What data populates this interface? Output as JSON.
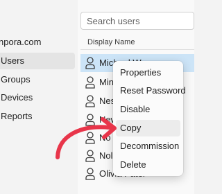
{
  "sidebar": {
    "domain": "npora.com",
    "items": [
      {
        "label": "Users",
        "active": true
      },
      {
        "label": "Groups",
        "active": false
      },
      {
        "label": "Devices",
        "active": false
      },
      {
        "label": "Reports",
        "active": false
      }
    ]
  },
  "search": {
    "placeholder": "Search users"
  },
  "table": {
    "column_header": "Display Name",
    "rows": [
      {
        "name": "Michael Wong",
        "selected": true
      },
      {
        "name": "Min",
        "selected": false
      },
      {
        "name": "Nes",
        "selected": false
      },
      {
        "name": "New",
        "selected": false
      },
      {
        "name": "No",
        "selected": false
      },
      {
        "name": "Nol",
        "selected": false
      },
      {
        "name": "Olivia Pater",
        "selected": false
      }
    ]
  },
  "context_menu": {
    "items": [
      {
        "label": "Properties"
      },
      {
        "label": "Reset Password"
      },
      {
        "label": "Disable"
      },
      {
        "label": "Copy",
        "highlighted": true
      },
      {
        "label": "Decommission"
      },
      {
        "label": "Delete"
      }
    ]
  },
  "annotation": {
    "arrow_color": "#e8354a",
    "target": "Copy"
  },
  "colors": {
    "selection": "#cce4f7",
    "icon": "#3a3a3a"
  }
}
